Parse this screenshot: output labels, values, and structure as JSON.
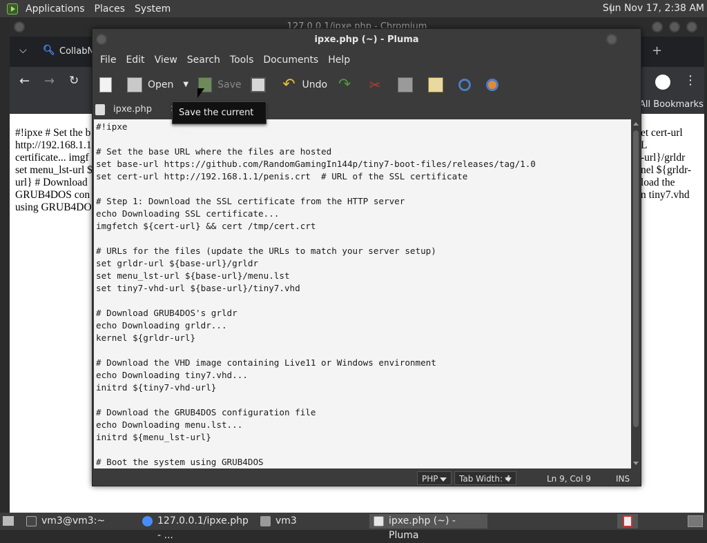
{
  "top_panel": {
    "menus": [
      "Applications",
      "Places",
      "System"
    ],
    "clock": "Sun Nov 17,  2:38 AM"
  },
  "chromium": {
    "title": "127.0.0.1/ipxe.php - Chromium",
    "tab_label": "CollabN",
    "bookmarks_label": "All Bookmarks",
    "page_left_text": "#!ipxe # Set the b\nhttp://192.168.1.1\ncertificate... imgf\nset menu_lst-url $\nurl} # Download\nGRUB4DOS con\nusing GRUB4DO",
    "page_right_text": "et cert-url\nL\n-url}/grldr\nnel ${grldr-\nload the\nn tiny7.vhd"
  },
  "pluma": {
    "title": "ipxe.php (~) - Pluma",
    "menus": [
      "File",
      "Edit",
      "View",
      "Search",
      "Tools",
      "Documents",
      "Help"
    ],
    "toolbar": {
      "open_label": "Open",
      "save_label": "Save",
      "undo_label": "Undo"
    },
    "tab_label": "ipxe.php",
    "tooltip": "Save the current file",
    "code_lines": [
      "#!ipxe",
      "",
      "# Set the base URL where the files are hosted",
      "set base-url https://github.com/RandomGamingIn144p/tiny7-boot-files/releases/tag/1.0",
      "set cert-url http://192.168.1.1/penis.crt  # URL of the SSL certificate",
      "",
      "# Step 1: Download the SSL certificate from the HTTP server",
      "echo Downloading SSL certificate...",
      "imgfetch ${cert-url} && cert /tmp/cert.crt",
      "",
      "# URLs for the files (update the URLs to match your server setup)",
      "set grldr-url ${base-url}/grldr",
      "set menu_lst-url ${base-url}/menu.lst",
      "set tiny7-vhd-url ${base-url}/tiny7.vhd",
      "",
      "# Download GRUB4DOS's grldr",
      "echo Downloading grldr...",
      "kernel ${grldr-url}",
      "",
      "# Download the VHD image containing Live11 or Windows environment",
      "echo Downloading tiny7.vhd...",
      "initrd ${tiny7-vhd-url}",
      "",
      "# Download the GRUB4DOS configuration file",
      "echo Downloading menu.lst...",
      "initrd ${menu_lst-url}",
      "",
      "# Boot the system using GRUB4DOS"
    ],
    "status": {
      "language": "PHP",
      "tab_width": "Tab Width:  4",
      "position": "Ln 9, Col 9",
      "mode": "INS"
    }
  },
  "taskbar": {
    "items": [
      "vm3@vm3:~",
      "127.0.0.1/ipxe.php - ...",
      "vm3",
      "ipxe.php (~) - Pluma"
    ]
  },
  "colors": {
    "panel": "#3c3c3c",
    "editor_bg": "#f4f4f4",
    "window_bg": "#3b3b3b"
  }
}
